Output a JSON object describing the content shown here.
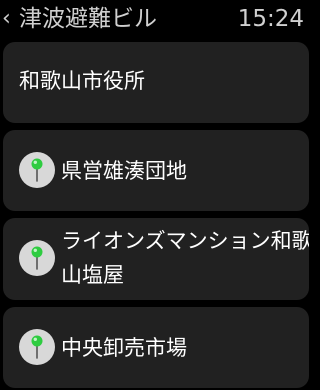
{
  "status_bar": {
    "back_glyph": "‹",
    "title": "津波避難ビル",
    "time": "15:24"
  },
  "list": {
    "items": [
      {
        "label": "和歌山市役所",
        "has_pin": false
      },
      {
        "label": "県営雄湊団地",
        "has_pin": true,
        "icon": "map-pin-icon"
      },
      {
        "label": "ライオンズマンション和歌山塩屋",
        "has_pin": true,
        "icon": "map-pin-icon"
      },
      {
        "label": "中央卸売市場",
        "has_pin": true,
        "icon": "map-pin-icon"
      }
    ]
  },
  "colors": {
    "background": "#000000",
    "card": "#212121",
    "pin_head": "#2ecc40",
    "pin_disc": "#d8d8d8",
    "header_text": "#d0d0d0"
  }
}
